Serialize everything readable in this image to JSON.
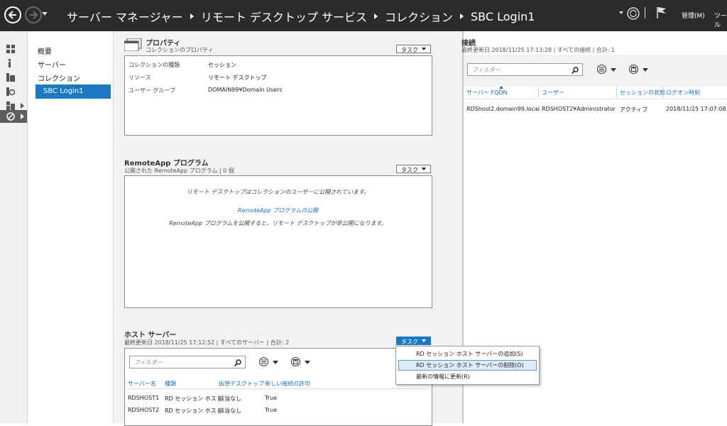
{
  "header": {
    "breadcrumb": [
      "サーバー マネージャー",
      "リモート デスクトップ サービス",
      "コレクション",
      "SBC Login1"
    ],
    "manage_label": "管理(M)",
    "tools_label": "ツール"
  },
  "nav": {
    "items": [
      "概要",
      "サーバー",
      "コレクション"
    ],
    "selected": "SBC Login1"
  },
  "properties": {
    "title": "プロパティ",
    "subtitle": "コレクションのプロパティ",
    "task_label": "タスク",
    "rows": [
      {
        "key": "コレクションの種類",
        "value": "セッション"
      },
      {
        "key": "リソース",
        "value": "リモート デスクトップ"
      },
      {
        "key": "ユーザー グループ",
        "value": "DOMAIN99¥Domain Users"
      }
    ]
  },
  "remoteapp": {
    "title": "RemoteApp プログラム",
    "subtitle": "公開された RemoteApp プログラム | 0 個",
    "task_label": "タスク",
    "message": "リモート デスクトップはコレクションのユーザーに公開されています。",
    "publish_link": "RemoteApp プログラムの公開",
    "note": "RemoteApp プログラムを公開すると、リモート デスクトップが非公開になります。"
  },
  "host_servers": {
    "title": "ホスト サーバー",
    "subtitle": "最終更新日 2018/11/25 17:12:52 | すべてのサーバー | 合計: 2",
    "task_label": "タスク",
    "filter_placeholder": "フィルター",
    "columns": [
      "サーバー名",
      "種類",
      "仮想デスクトップ",
      "新しい接続の許可"
    ],
    "rows": [
      [
        "RDSHOST1",
        "RD セッション ホスト",
        "該当なし",
        "True"
      ],
      [
        "RDSHOST2",
        "RD セッション ホスト",
        "該当なし",
        "True"
      ]
    ]
  },
  "context_menu": {
    "items": [
      "RD セッション ホスト サーバーの追加(S)",
      "RD セッション ホスト サーバーの削除(O)",
      "最新の情報に更新(R)"
    ],
    "highlighted_index": 1
  },
  "connections": {
    "title": "接続",
    "subtitle": "最終更新日 2018/11/25 17:13:28 | すべての接続 | 合計: 1",
    "filter_placeholder": "フィルター",
    "columns": [
      "サーバー FQDN",
      "ユーザー",
      "セッションの状態",
      "ログオン時刻"
    ],
    "rows": [
      [
        "RDShost2.domain99.local",
        "RDSHOST2¥Administrator",
        "アクティブ",
        "2018/11/25 17:07:08"
      ]
    ]
  },
  "colors": {
    "header_bg": "#2b2b2b",
    "accent": "#1b79c2",
    "link": "#1b6fb0",
    "highlight": "#dcebf7"
  },
  "icons": [
    "back-icon",
    "forward-icon",
    "refresh-icon",
    "flag-icon",
    "search-icon",
    "list-options-icon",
    "save-query-icon",
    "dashboard-icon",
    "local-server-icon",
    "all-servers-icon",
    "file-storage-icon",
    "ad-ds-icon",
    "remote-desktop-icon"
  ]
}
